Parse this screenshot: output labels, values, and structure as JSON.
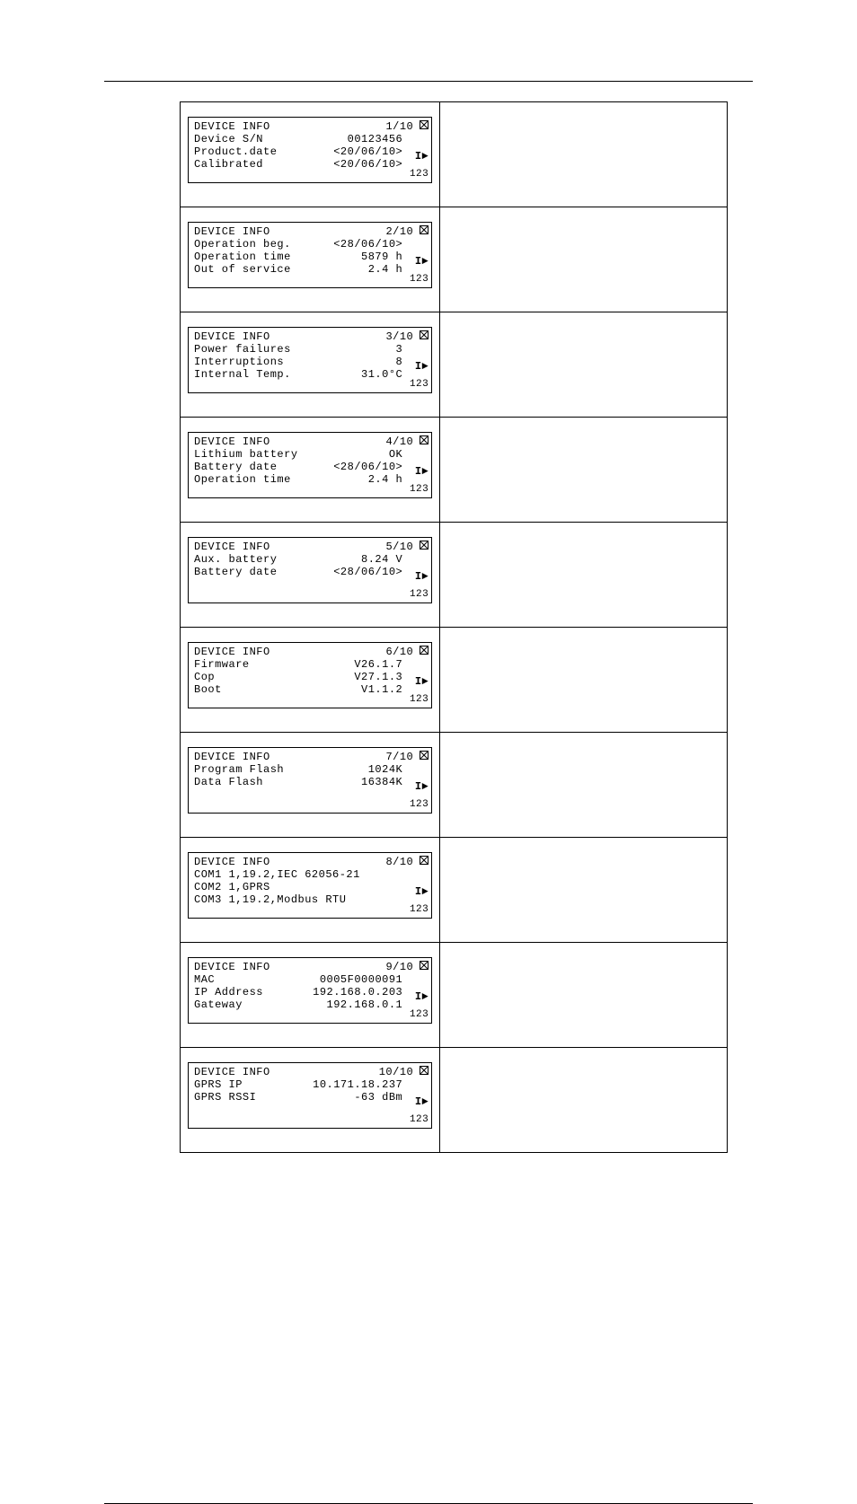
{
  "indicators": {
    "arrow": "I►",
    "num": "123"
  },
  "screens": [
    {
      "title": "DEVICE INFO",
      "page": "1/10",
      "rows": [
        {
          "label": "Device S/N",
          "value": "00123456"
        },
        {
          "label": "Product.date",
          "value": "<20/06/10>"
        },
        {
          "label": "Calibrated",
          "value": "<20/06/10>"
        }
      ]
    },
    {
      "title": "DEVICE INFO",
      "page": "2/10",
      "rows": [
        {
          "label": "Operation beg.",
          "value": "<28/06/10>"
        },
        {
          "label": "Operation time",
          "value": "5879 h"
        },
        {
          "label": "Out of service",
          "value": "2.4 h"
        }
      ]
    },
    {
      "title": "DEVICE INFO",
      "page": "3/10",
      "rows": [
        {
          "label": "Power failures",
          "value": "3"
        },
        {
          "label": "Interruptions",
          "value": "8"
        },
        {
          "label": "Internal Temp.",
          "value": "31.0°C"
        }
      ]
    },
    {
      "title": "DEVICE INFO",
      "page": "4/10",
      "rows": [
        {
          "label": "Lithium battery",
          "value": "OK"
        },
        {
          "label": "Battery date",
          "value": "<28/06/10>"
        },
        {
          "label": "Operation time",
          "value": "2.4 h"
        }
      ]
    },
    {
      "title": "DEVICE INFO",
      "page": "5/10",
      "rows": [
        {
          "label": "Aux. battery",
          "value": "8.24 V"
        },
        {
          "label": "Battery date",
          "value": "<28/06/10>"
        }
      ]
    },
    {
      "title": "DEVICE INFO",
      "page": "6/10",
      "rows": [
        {
          "label": "Firmware",
          "value": "V26.1.7"
        },
        {
          "label": "Cop",
          "value": "V27.1.3"
        },
        {
          "label": "Boot",
          "value": "V1.1.2"
        }
      ]
    },
    {
      "title": "DEVICE INFO",
      "page": "7/10",
      "rows": [
        {
          "label": "Program Flash",
          "value": "1024K"
        },
        {
          "label": "Data Flash",
          "value": "16384K"
        }
      ]
    },
    {
      "title": "DEVICE INFO",
      "page": "8/10",
      "lines": [
        "COM1 1,19.2,IEC 62056-21",
        "COM2 1,GPRS",
        "COM3 1,19.2,Modbus RTU"
      ]
    },
    {
      "title": "DEVICE INFO",
      "page": "9/10",
      "rows": [
        {
          "label": "MAC",
          "value": "0005F0000091"
        },
        {
          "label": "IP Address",
          "value": "192.168.0.203"
        },
        {
          "label": "Gateway",
          "value": "192.168.0.1"
        }
      ]
    },
    {
      "title": "DEVICE INFO",
      "page": "10/10",
      "rows": [
        {
          "label": "GPRS IP",
          "value": "10.171.18.237"
        },
        {
          "label": "GPRS RSSI",
          "value": "-63 dBm"
        }
      ]
    }
  ]
}
